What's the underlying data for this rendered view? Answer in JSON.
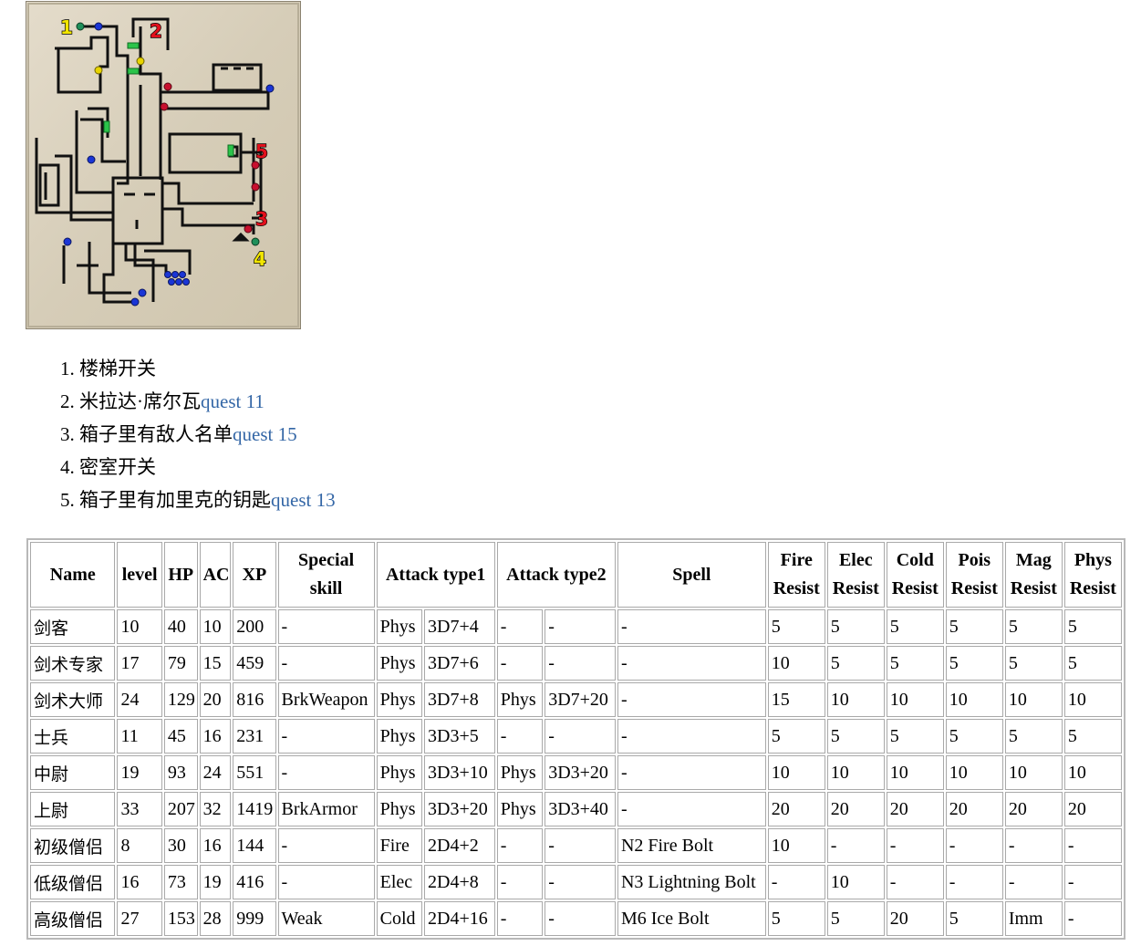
{
  "map": {
    "markers": [
      "1",
      "2",
      "3",
      "4",
      "5"
    ],
    "colors": {
      "background": "#d8d0bd",
      "wall": "#111111",
      "door": "#2bc44a",
      "orb_blue": "#1a35d6",
      "orb_red": "#c8102e",
      "orb_yellow": "#e8d400",
      "orb_green": "#1e8f5a",
      "label_yellow": "#f2e600",
      "label_red": "#e3101c"
    }
  },
  "legend": [
    {
      "num": "1.",
      "text": "楼梯开关",
      "quest": ""
    },
    {
      "num": "2.",
      "text": "米拉达·席尔瓦",
      "quest": "quest 11"
    },
    {
      "num": "3.",
      "text": "箱子里有敌人名单",
      "quest": "quest 15"
    },
    {
      "num": "4.",
      "text": "密室开关",
      "quest": ""
    },
    {
      "num": "5.",
      "text": "箱子里有加里克的钥匙",
      "quest": "quest 13"
    }
  ],
  "table": {
    "headers": [
      "Name",
      "level",
      "HP",
      "AC",
      "XP",
      "Special skill",
      "Attack type1",
      "Attack type2",
      "Spell",
      "Fire Resist",
      "Elec Resist",
      "Cold Resist",
      "Pois Resist",
      "Mag Resist",
      "Phys Resist"
    ],
    "rows": [
      [
        "剑客",
        "10",
        "40",
        "10",
        "200",
        "-",
        "Phys",
        "3D7+4",
        "-",
        "-",
        "-",
        "5",
        "5",
        "5",
        "5",
        "5",
        "5"
      ],
      [
        "剑术专家",
        "17",
        "79",
        "15",
        "459",
        "-",
        "Phys",
        "3D7+6",
        "-",
        "-",
        "-",
        "10",
        "5",
        "5",
        "5",
        "5",
        "5"
      ],
      [
        "剑术大师",
        "24",
        "129",
        "20",
        "816",
        "BrkWeapon",
        "Phys",
        "3D7+8",
        "Phys",
        "3D7+20",
        "-",
        "15",
        "10",
        "10",
        "10",
        "10",
        "10"
      ],
      [
        "士兵",
        "11",
        "45",
        "16",
        "231",
        "-",
        "Phys",
        "3D3+5",
        "-",
        "-",
        "-",
        "5",
        "5",
        "5",
        "5",
        "5",
        "5"
      ],
      [
        "中尉",
        "19",
        "93",
        "24",
        "551",
        "-",
        "Phys",
        "3D3+10",
        "Phys",
        "3D3+20",
        "-",
        "10",
        "10",
        "10",
        "10",
        "10",
        "10"
      ],
      [
        "上尉",
        "33",
        "207",
        "32",
        "1419",
        "BrkArmor",
        "Phys",
        "3D3+20",
        "Phys",
        "3D3+40",
        "-",
        "20",
        "20",
        "20",
        "20",
        "20",
        "20"
      ],
      [
        "初级僧侣",
        "8",
        "30",
        "16",
        "144",
        "-",
        "Fire",
        "2D4+2",
        "-",
        "-",
        "N2 Fire Bolt",
        "10",
        "-",
        "-",
        "-",
        "-",
        "-"
      ],
      [
        "低级僧侣",
        "16",
        "73",
        "19",
        "416",
        "-",
        "Elec",
        "2D4+8",
        "-",
        "-",
        "N3 Lightning Bolt",
        "-",
        "10",
        "-",
        "-",
        "-",
        "-"
      ],
      [
        "高级僧侣",
        "27",
        "153",
        "28",
        "999",
        "Weak",
        "Cold",
        "2D4+16",
        "-",
        "-",
        "M6 Ice Bolt",
        "5",
        "5",
        "20",
        "5",
        "Imm",
        "-"
      ]
    ]
  }
}
